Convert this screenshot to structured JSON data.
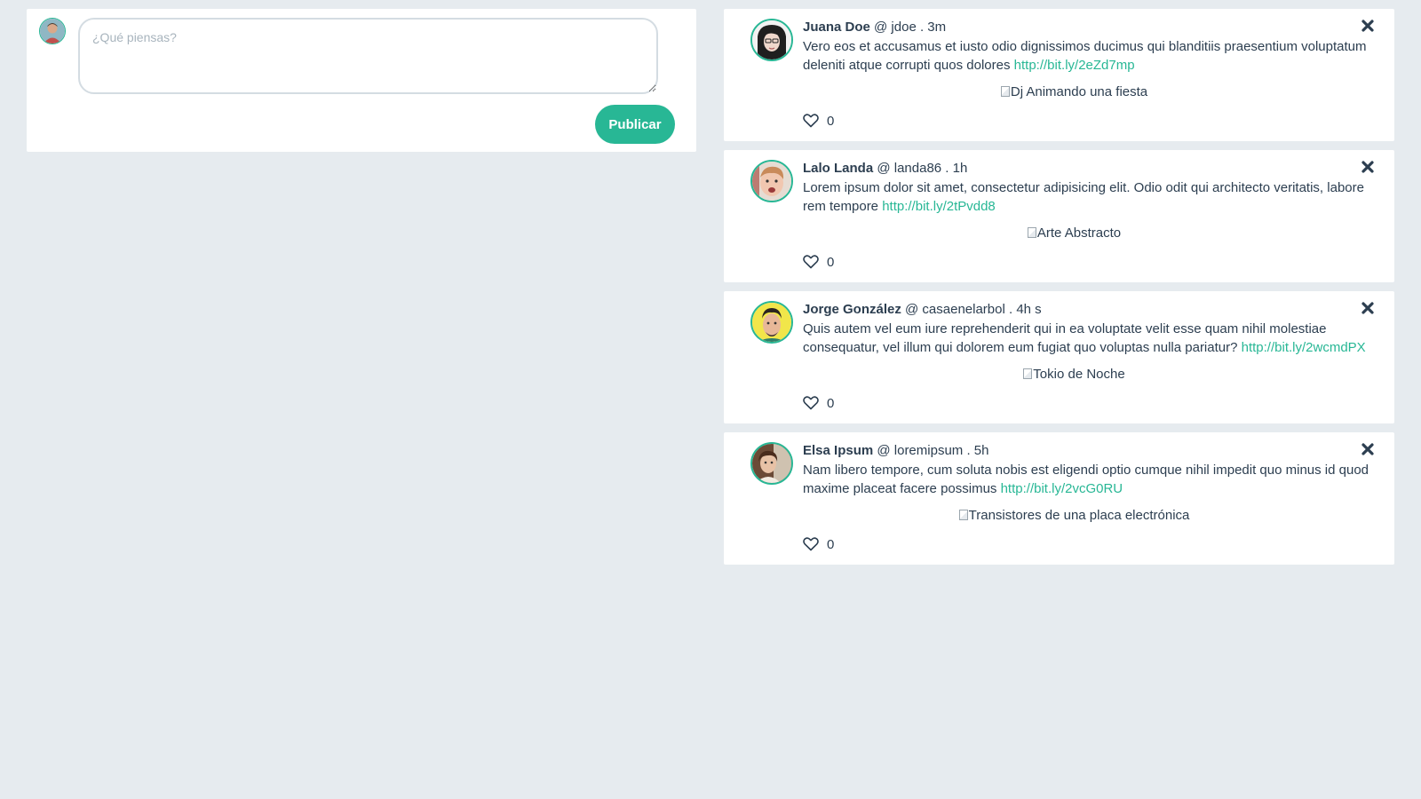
{
  "compose": {
    "placeholder": "¿Qué piensas?",
    "publish_label": "Publicar",
    "avatar_icon": "user-avatar-icon"
  },
  "colors": {
    "accent": "#28b795",
    "background": "#e6ebef",
    "text": "#2c3e50"
  },
  "posts": [
    {
      "name": "Juana Doe",
      "meta": " @ jdoe . 3m",
      "text": "Vero eos et accusamus et iusto odio dignissimos ducimus qui blanditiis praesentium voluptatum deleniti atque corrupti quos dolores ",
      "link": "http://bit.ly/2eZd7mp",
      "image_alt": "Dj Animando una fiesta",
      "likes": "0"
    },
    {
      "name": "Lalo Landa",
      "meta": " @ landa86 . 1h",
      "text": "Lorem ipsum dolor sit amet, consectetur adipisicing elit. Odio odit qui architecto veritatis, labore rem tempore ",
      "link": "http://bit.ly/2tPvdd8",
      "image_alt": "Arte Abstracto",
      "likes": "0"
    },
    {
      "name": "Jorge González",
      "meta": " @ casaenelarbol . 4h s",
      "text": "Quis autem vel eum iure reprehenderit qui in ea voluptate velit esse quam nihil molestiae consequatur, vel illum qui dolorem eum fugiat quo voluptas nulla pariatur? ",
      "link": "http://bit.ly/2wcmdPX",
      "image_alt": "Tokio de Noche",
      "likes": "0"
    },
    {
      "name": "Elsa Ipsum",
      "meta": " @ loremipsum . 5h",
      "text": "Nam libero tempore, cum soluta nobis est eligendi optio cumque nihil impedit quo minus id quod maxime placeat facere possimus ",
      "link": "http://bit.ly/2vcG0RU",
      "image_alt": "Transistores de una placa electrónica",
      "likes": "0"
    }
  ]
}
